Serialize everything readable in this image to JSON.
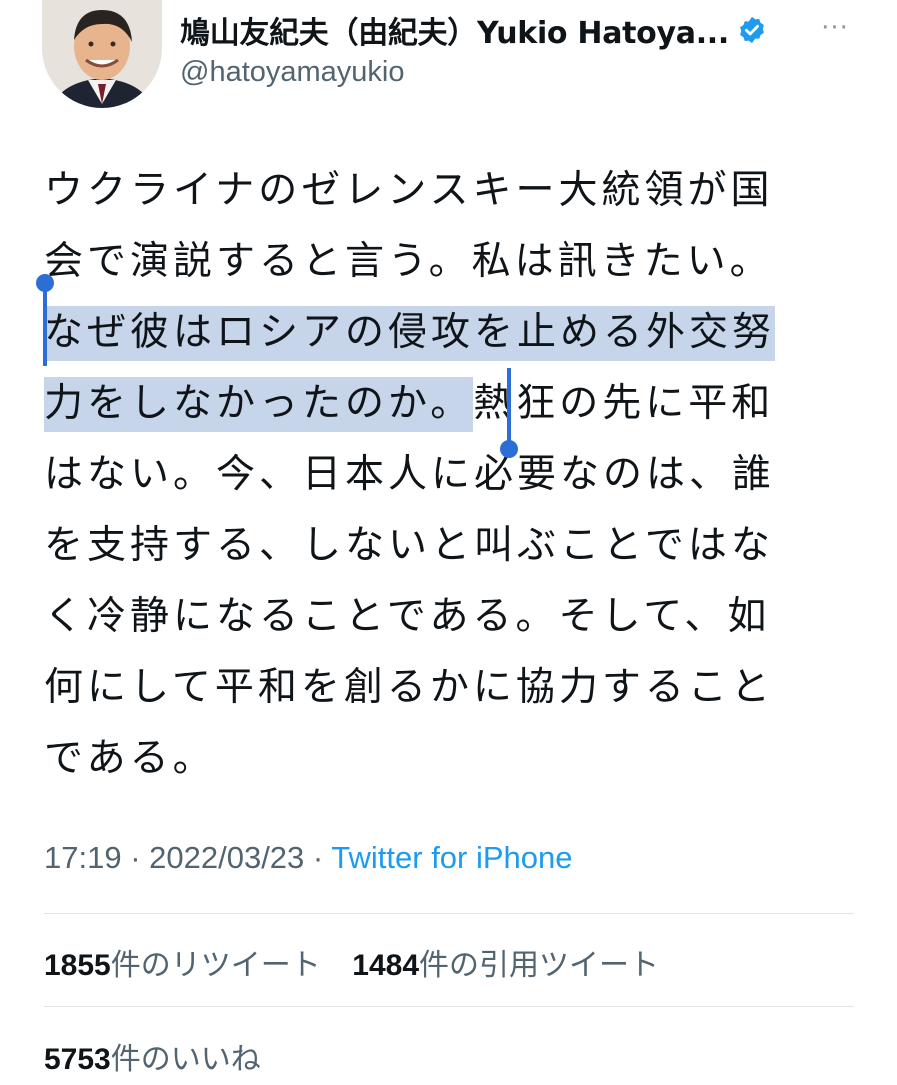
{
  "author": {
    "display_name": "鳩山友紀夫（由紀夫）Yukio Hatoya...",
    "handle": "@hatoyamayukio",
    "avatar_icon": "profile-photo",
    "verified_icon": "verified-badge-icon",
    "more_icon": "more-options-icon"
  },
  "tweet": {
    "lines": [
      {
        "before": "ウクライナのゼレンスキー大統領が国",
        "highlight": "",
        "after": ""
      },
      {
        "before": "会で演説すると言う。私は訊きたい。",
        "highlight": "",
        "after": ""
      },
      {
        "before": "",
        "highlight": "なぜ彼はロシアの侵攻を止める外交努",
        "after": ""
      },
      {
        "before": "",
        "highlight": "力をしなかったのか。",
        "after": "熱狂の先に平和"
      },
      {
        "before": "はない。今、日本人に必要なのは、誰",
        "highlight": "",
        "after": ""
      },
      {
        "before": "を支持する、しないと叫ぶことではな",
        "highlight": "",
        "after": ""
      },
      {
        "before": "く冷静になることである。そして、如",
        "highlight": "",
        "after": ""
      },
      {
        "before": "何にして平和を創るかに協力すること",
        "highlight": "",
        "after": ""
      },
      {
        "before": "である。",
        "highlight": "",
        "after": ""
      }
    ]
  },
  "meta": {
    "time": "17:19",
    "sep1": " · ",
    "date": "2022/03/23",
    "sep2": " · ",
    "source": "Twitter for iPhone"
  },
  "stats": {
    "retweets_count": "1855",
    "retweets_label": "件のリツイート",
    "quotes_count": "1484",
    "quotes_label": "件の引用ツイート",
    "likes_count": "5753",
    "likes_label": "件のいいね"
  },
  "colors": {
    "selection_highlight": "#c7d5ea",
    "selection_handle": "#2b6fd6",
    "link": "#1d9bf0",
    "verified": "#1d9bf0"
  }
}
